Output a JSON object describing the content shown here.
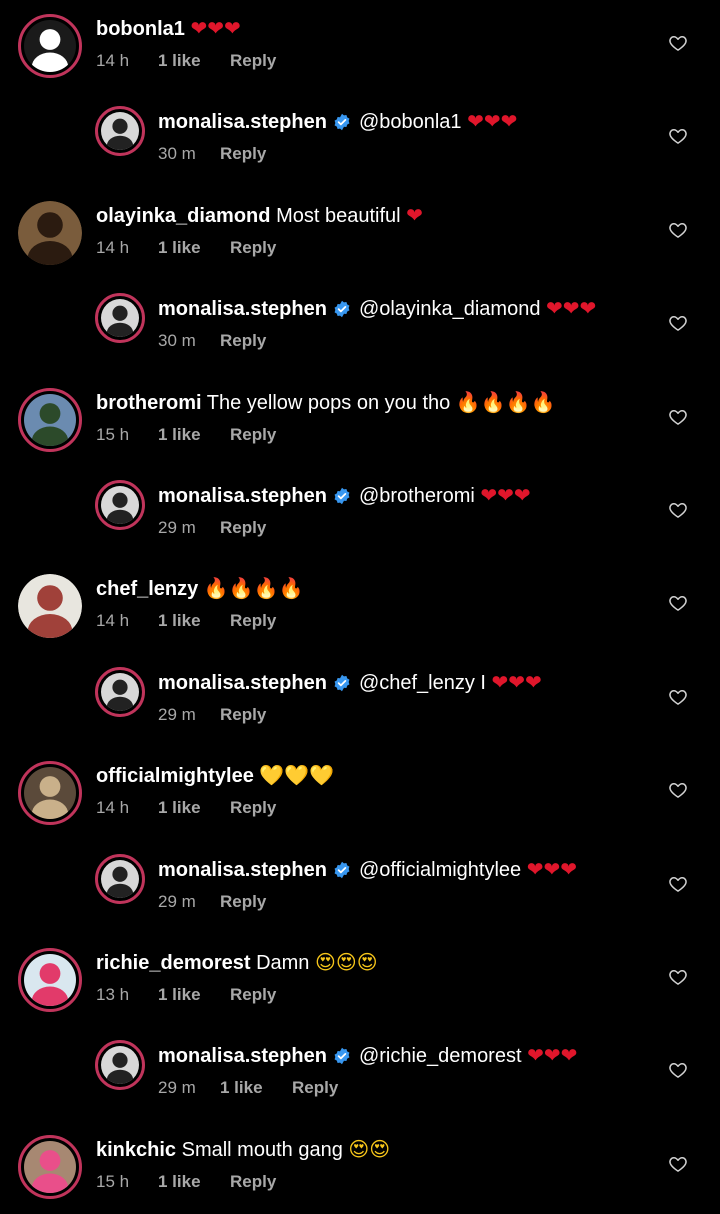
{
  "comments": [
    {
      "user": "bobonla1",
      "body": "",
      "emoji": "❤❤❤",
      "emoji_color": "#e0162b",
      "time": "14 h",
      "likes": "1 like",
      "reply": "Reply",
      "verified": false,
      "level": 0
    },
    {
      "user": "monalisa.stephen",
      "body": "@bobonla1",
      "emoji": "❤❤❤",
      "emoji_color": "#e0162b",
      "time": "30 m",
      "likes": "",
      "reply": "Reply",
      "verified": true,
      "level": 1
    },
    {
      "user": "olayinka_diamond",
      "body": "Most beautiful",
      "emoji": "❤",
      "emoji_color": "#e0162b",
      "time": "14 h",
      "likes": "1 like",
      "reply": "Reply",
      "verified": false,
      "level": 0
    },
    {
      "user": "monalisa.stephen",
      "body": "@olayinka_diamond",
      "emoji": "❤❤❤",
      "emoji_color": "#e0162b",
      "time": "30 m",
      "likes": "",
      "reply": "Reply",
      "verified": true,
      "level": 1
    },
    {
      "user": "brotheromi",
      "body": "The yellow pops on you tho",
      "emoji": "🔥🔥🔥🔥",
      "emoji_color": "#ff7a1a",
      "time": "15 h",
      "likes": "1 like",
      "reply": "Reply",
      "verified": false,
      "level": 0
    },
    {
      "user": "monalisa.stephen",
      "body": "@brotheromi",
      "emoji": "❤❤❤",
      "emoji_color": "#e0162b",
      "time": "29 m",
      "likes": "",
      "reply": "Reply",
      "verified": true,
      "level": 1
    },
    {
      "user": "chef_lenzy",
      "body": "",
      "emoji": "🔥🔥🔥🔥",
      "emoji_color": "#ff7a1a",
      "time": "14 h",
      "likes": "1 like",
      "reply": "Reply",
      "verified": false,
      "level": 0
    },
    {
      "user": "monalisa.stephen",
      "body": "@chef_lenzy I",
      "emoji": "❤❤❤",
      "emoji_color": "#e0162b",
      "time": "29 m",
      "likes": "",
      "reply": "Reply",
      "verified": true,
      "level": 1
    },
    {
      "user": "officialmightylee",
      "body": "",
      "emoji": "💛💛💛",
      "emoji_color": "#f7c61a",
      "time": "14 h",
      "likes": "1 like",
      "reply": "Reply",
      "verified": false,
      "level": 0
    },
    {
      "user": "monalisa.stephen",
      "body": "@officialmightylee",
      "emoji": "❤❤❤",
      "emoji_color": "#e0162b",
      "time": "29 m",
      "likes": "",
      "reply": "Reply",
      "verified": true,
      "level": 1
    },
    {
      "user": "richie_demorest",
      "body": "Damn",
      "emoji": "😍😍😍",
      "emoji_color": "#f7c61a",
      "time": "13 h",
      "likes": "1 like",
      "reply": "Reply",
      "verified": false,
      "level": 0
    },
    {
      "user": "monalisa.stephen",
      "body": "@richie_demorest",
      "emoji": "❤❤❤",
      "emoji_color": "#e0162b",
      "time": "29 m",
      "likes": "1 like",
      "reply": "Reply",
      "verified": true,
      "level": 1
    },
    {
      "user": "kinkchic",
      "body": "Small mouth gang",
      "emoji": "😍😍",
      "emoji_color": "#f7c61a",
      "time": "15 h",
      "likes": "1 like",
      "reply": "Reply",
      "verified": false,
      "level": 0
    }
  ],
  "colors": {
    "background": "#000000",
    "muted_text": "#a8a8a8",
    "verified_blue": "#3897f0",
    "story_ring": "#c0345b"
  },
  "icons": {
    "like": "heart-outline-icon",
    "verified": "verified-badge-icon"
  }
}
